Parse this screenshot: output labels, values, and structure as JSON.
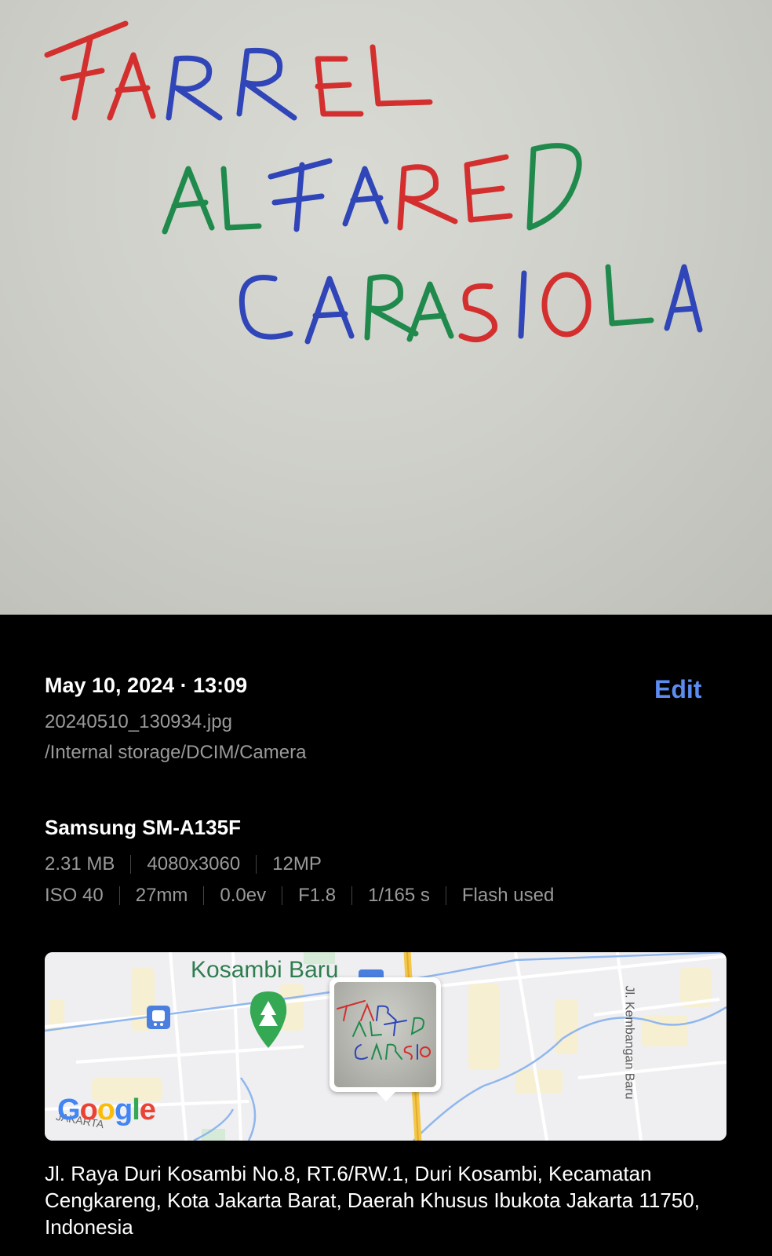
{
  "photo": {
    "handwriting": [
      "FARREL",
      "ALFARED",
      "CARASIOLA"
    ]
  },
  "info": {
    "date_time": "May 10, 2024 · 13:09",
    "edit_label": "Edit",
    "filename": "20240510_130934.jpg",
    "path": "/Internal storage/DCIM/Camera"
  },
  "camera": {
    "model": "Samsung SM-A135F",
    "size": "2.31 MB",
    "resolution": "4080x3060",
    "megapixels": "12MP",
    "iso": "ISO 40",
    "focal_length": "27mm",
    "exposure_value": "0.0ev",
    "aperture": "F1.8",
    "shutter": "1/165 s",
    "flash": "Flash used"
  },
  "map": {
    "area_label": "Kosambi Baru",
    "street_label": "Jl. Kembangan Baru",
    "small_label": "JAKARTA",
    "brand": "Google",
    "colors": {
      "brand_blue": "#4285F4",
      "brand_red": "#EA4335",
      "brand_yellow": "#FBBC05",
      "brand_green": "#34A853",
      "park_pin": "#34a853",
      "transit_icon": "#4a7fe0"
    }
  },
  "location": {
    "address": "Jl. Raya Duri Kosambi No.8, RT.6/RW.1, Duri Kosambi, Kecamatan Cengkareng, Kota Jakarta Barat, Daerah Khusus Ibukota Jakarta 11750, Indonesia"
  },
  "colors": {
    "accent": "#5b8cf1",
    "background": "#000000",
    "secondary_text": "#9a9a9a",
    "ink_red": "#d32f2f",
    "ink_blue": "#2f45b8",
    "ink_green": "#1f8a4c"
  }
}
